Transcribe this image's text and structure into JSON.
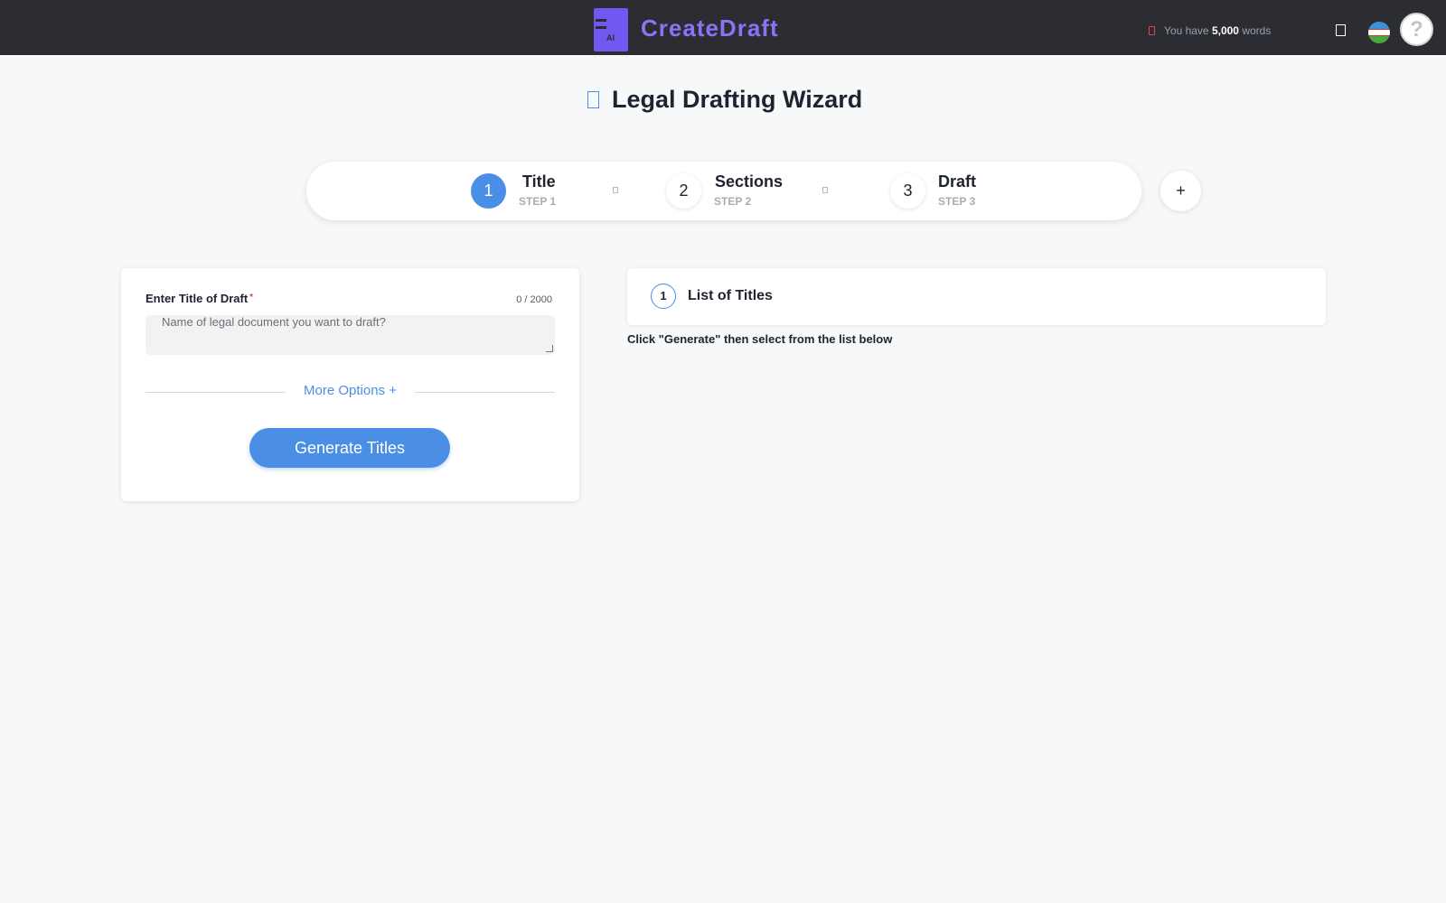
{
  "header": {
    "logo_text": "AI",
    "brand": "CreateDraft",
    "words_prefix": "You have",
    "words_count": "5,000",
    "words_suffix": "words",
    "avatar_glyph": "?",
    "icons": [
      "ticket-icon",
      "square-icon",
      "flag-icon",
      "avatar-icon"
    ],
    "flag_colors": [
      "#3d8fd6",
      "#ffffff",
      "#4aa83c"
    ]
  },
  "page": {
    "title": "Legal Drafting Wizard"
  },
  "stepper": {
    "steps": [
      {
        "number": "1",
        "label": "Title",
        "sub": "STEP 1",
        "active": true
      },
      {
        "number": "2",
        "label": "Sections",
        "sub": "STEP 2",
        "active": false
      },
      {
        "number": "3",
        "label": "Draft",
        "sub": "STEP 3",
        "active": false
      }
    ],
    "add_label": "+"
  },
  "form": {
    "label": "Enter Title of Draft",
    "required_mark": "*",
    "counter": "0 / 2000",
    "placeholder": "Name of legal document you want to draft?",
    "value": "",
    "more_options": "More Options +",
    "generate_label": "Generate Titles"
  },
  "titles_panel": {
    "number": "1",
    "title": "List of Titles",
    "hint": "Click \"Generate\" then select from the list below"
  },
  "colors": {
    "accent": "#4a8ee6",
    "brand": "#7158f0",
    "header_bg": "#2b2d33",
    "required": "#e0454f"
  }
}
